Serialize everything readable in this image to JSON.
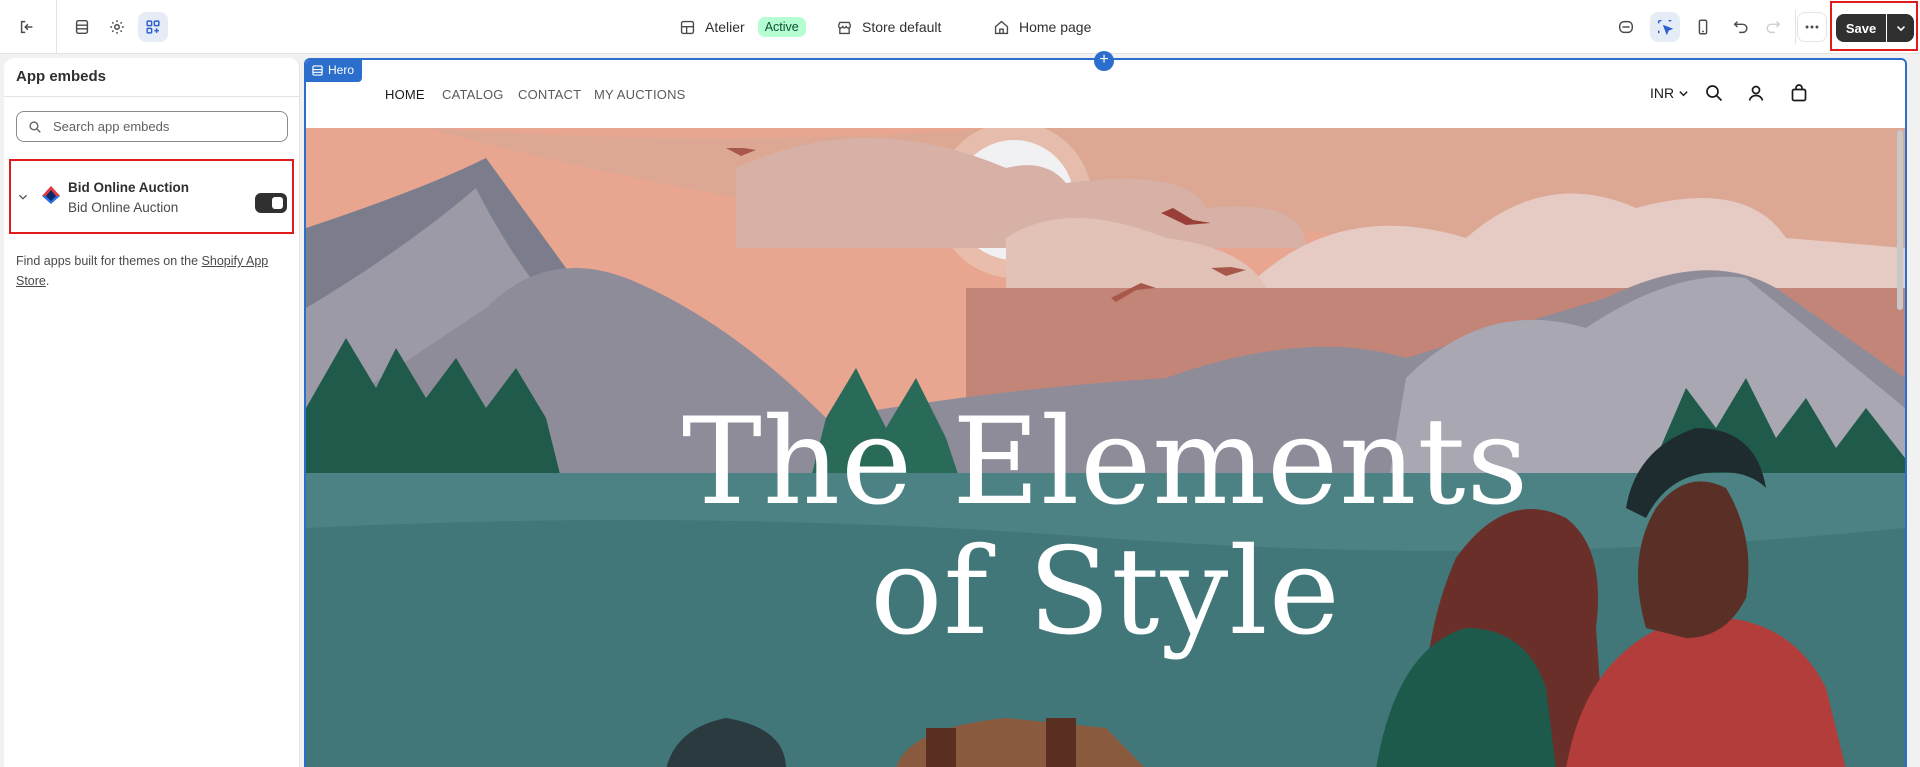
{
  "topbar": {
    "theme_name": "Atelier",
    "theme_status": "Active",
    "store": "Store default",
    "page": "Home page",
    "save_label": "Save"
  },
  "sidebar": {
    "title": "App embeds",
    "search_placeholder": "Search app embeds",
    "embed": {
      "title": "Bid Online Auction",
      "subtitle": "Bid Online Auction",
      "enabled": true
    },
    "footer_prefix": "Find apps built for themes on the ",
    "footer_link": "Shopify App Store",
    "footer_suffix": "."
  },
  "preview": {
    "section_tag": "Hero",
    "nav": [
      "HOME",
      "CATALOG",
      "CONTACT",
      "MY AUCTIONS"
    ],
    "currency": "INR",
    "hero_line1": "The Elements",
    "hero_line2": "of Style"
  },
  "colors": {
    "accent": "#2c6ecb",
    "highlight": "#e01b1b",
    "active_badge": "#b4fed2"
  }
}
